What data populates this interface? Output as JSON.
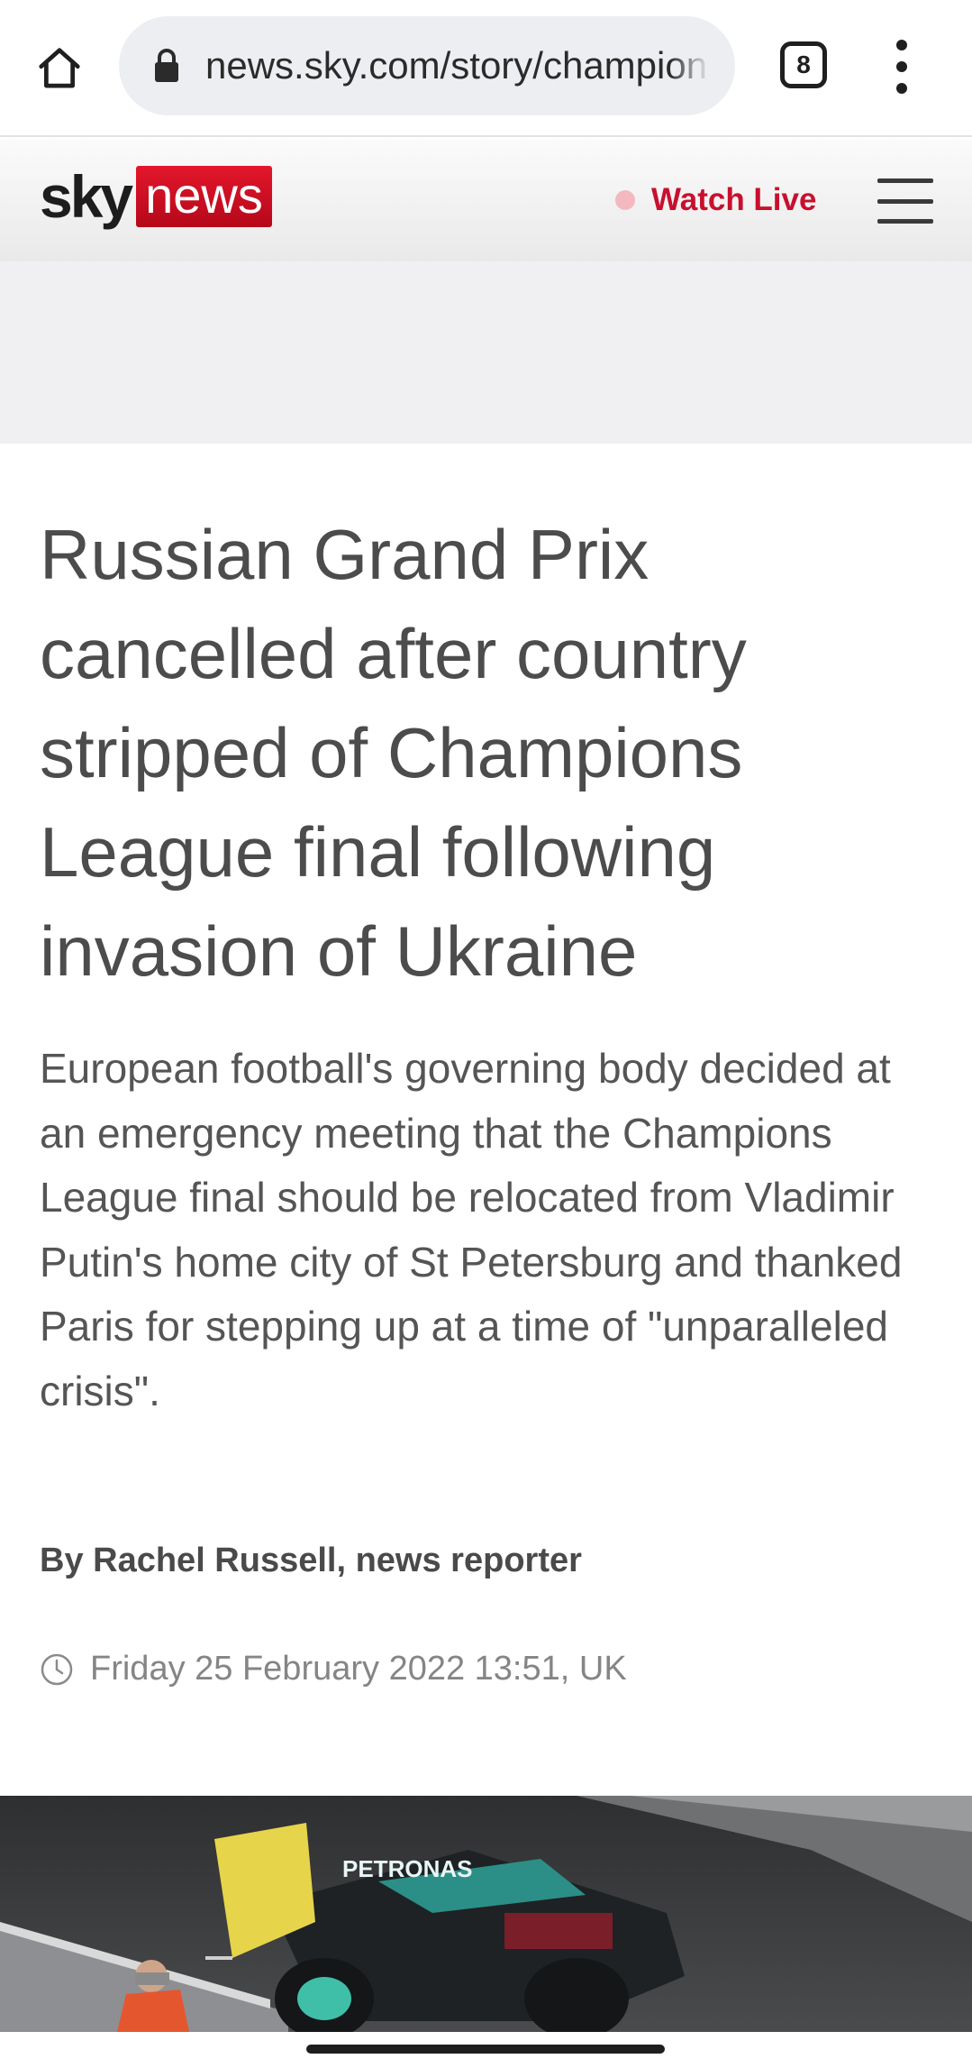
{
  "browser": {
    "url": "news.sky.com/story/champions",
    "tab_count": "8"
  },
  "site_header": {
    "logo_sky": "sky",
    "logo_news": "news",
    "watch_live_label": "Watch Live",
    "accent_color": "#c8102e"
  },
  "article": {
    "headline": "Russian Grand Prix cancelled after country stripped of Champions League final following invasion of Ukraine",
    "standfirst": "European football's governing body decided at an emergency meeting that the Champions League final should be relocated from Vladimir Putin's home city of St Petersburg and thanked Paris for stepping up at a time of \"unparalleled crisis\".",
    "byline": "By Rachel Russell, news reporter",
    "timestamp": "Friday 25 February 2022 13:51, UK"
  },
  "hero_image": {
    "car_sponsor_text": "PETRONAS"
  },
  "icons": {
    "home": "home-icon",
    "lock": "lock-icon",
    "tabs": "tabs-icon",
    "more": "more-vert-icon",
    "menu": "hamburger-menu-icon",
    "clock": "clock-icon"
  }
}
